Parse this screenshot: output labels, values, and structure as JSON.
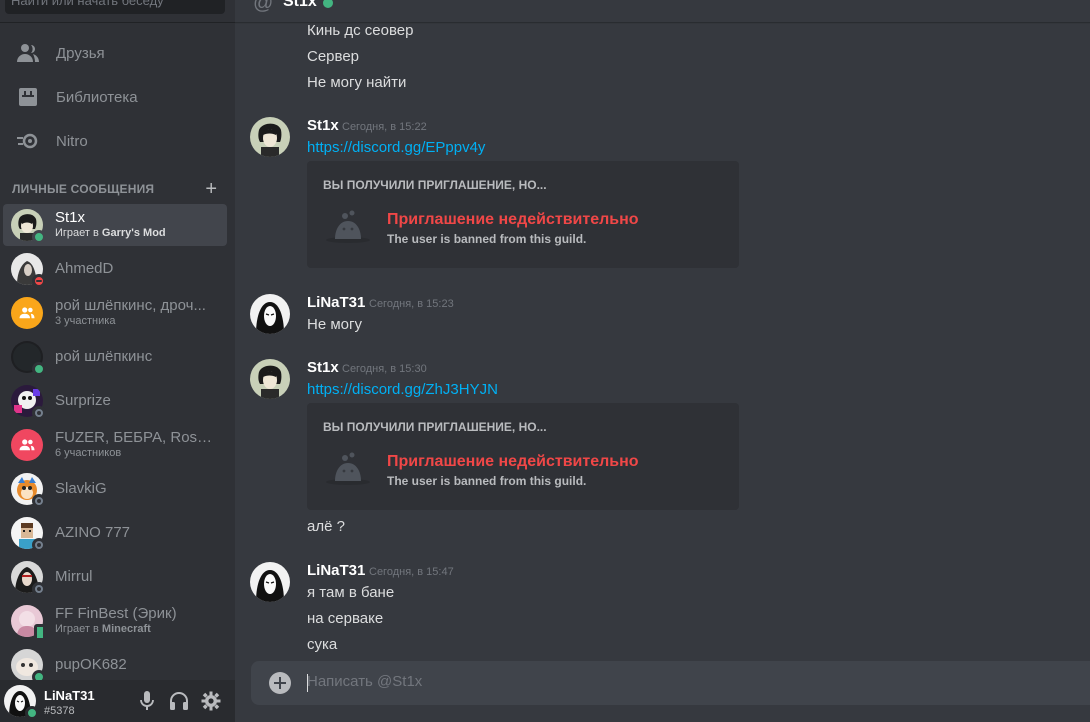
{
  "search": {
    "placeholder": "Найти или начать беседу"
  },
  "nav": [
    {
      "label": "Друзья",
      "icon": "friends-icon"
    },
    {
      "label": "Библиотека",
      "icon": "library-icon"
    },
    {
      "label": "Nitro",
      "icon": "nitro-icon"
    }
  ],
  "dm_section": {
    "title": "ЛИЧНЫЕ СООБЩЕНИЯ",
    "add_symbol": "+"
  },
  "dms": [
    {
      "name": "St1x",
      "sub_prefix": "Играет в ",
      "sub_game": "Garry's Mod",
      "status": "online",
      "active": true
    },
    {
      "name": "AhmedD",
      "status": "dnd"
    },
    {
      "name": "рой шлёпкинс, дроч...",
      "sub": "3 участника",
      "group": true,
      "color": "#faa61a"
    },
    {
      "name": "рой шлёпкинс",
      "status": "online"
    },
    {
      "name": "Surprize",
      "status": "offline"
    },
    {
      "name": "FUZER, БЕБРА, Rosti...",
      "sub": "6 участников",
      "group": true,
      "color": "#f04747"
    },
    {
      "name": "SlavkiG",
      "status": "offline"
    },
    {
      "name": "AZINO 777",
      "status": "offline"
    },
    {
      "name": "Mirrul",
      "status": "offline"
    },
    {
      "name": "FF FinBest (Эрик)",
      "sub_prefix": "Играет в ",
      "sub_game": "Minecraft",
      "status": "mobile"
    },
    {
      "name": "pupOK682",
      "status": "online"
    }
  ],
  "user_panel": {
    "name": "LiNaT31",
    "tag": "#5378",
    "status": "online"
  },
  "header": {
    "at": "@",
    "name": "St1x",
    "status": "online"
  },
  "messages": {
    "g0": [
      "Кинь дс сеовер",
      "Сервер",
      "Не могу найти"
    ],
    "g1": {
      "author": "St1x",
      "time": "Сегодня, в 15:22",
      "link": "https://discord.gg/EPppv4y"
    },
    "g2": {
      "author": "LiNaT31",
      "time": "Сегодня, в 15:23",
      "text": "Не могу"
    },
    "g3": {
      "author": "St1x",
      "time": "Сегодня, в 15:30",
      "link": "https://discord.gg/ZhJ3HYJN",
      "after": "алё ?"
    },
    "g4": {
      "author": "LiNaT31",
      "time": "Сегодня, в 15:47",
      "lines": [
        "я там в бане",
        "на серваке",
        "сука"
      ]
    }
  },
  "invite": {
    "heading": "ВЫ ПОЛУЧИЛИ ПРИГЛАШЕНИЕ, НО...",
    "title": "Приглашение недействительно",
    "desc": "The user is banned from this guild."
  },
  "composer": {
    "placeholder": "Написать @St1x"
  },
  "colors": {
    "sidebar_bg": "#2f3136",
    "chat_bg": "#36393f",
    "link": "#00b0f4",
    "error": "#f04747",
    "online": "#43b581"
  }
}
